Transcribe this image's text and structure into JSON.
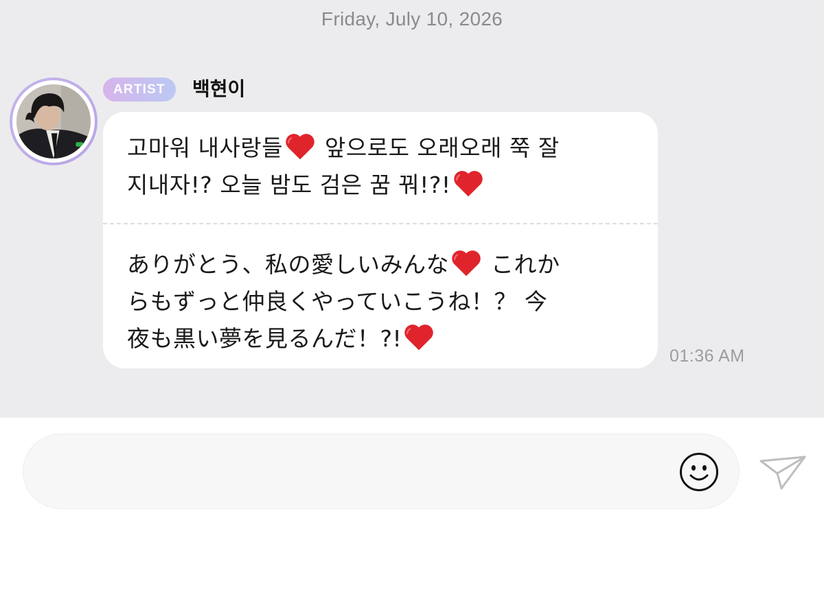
{
  "chat": {
    "date_label": "Friday, July 10, 2026",
    "sender": {
      "badge": "ARTIST",
      "name": "백현이"
    },
    "message": {
      "korean": {
        "line1_before_heart": "고마워 내사랑들",
        "line1_after_heart": " 앞으로도 오래오래 쭉 잘",
        "line2_before_heart": "지내자!? 오늘 밤도 검은 꿈 꿔!?!"
      },
      "japanese": {
        "line1_before_heart": "ありがとう、私の愛しいみんな",
        "line1_after_heart": " これか",
        "line2": "らもずっと仲良くやっていこうね！？ 今",
        "line3_before_heart": "夜も黒い夢を見るんだ！?!"
      },
      "timestamp": "01:36 AM"
    }
  },
  "composer": {
    "input_value": "",
    "emoji_icon": "smiley-icon",
    "send_icon": "paper-plane-icon"
  },
  "colors": {
    "chat_background": "#ececee",
    "bubble": "#ffffff",
    "badge_gradient_start": "#d6b4ec",
    "badge_gradient_end": "#bcc8f3",
    "avatar_ring": "#c6b6ec",
    "heart": "#e0242c",
    "muted_text": "#8a8a8e"
  }
}
